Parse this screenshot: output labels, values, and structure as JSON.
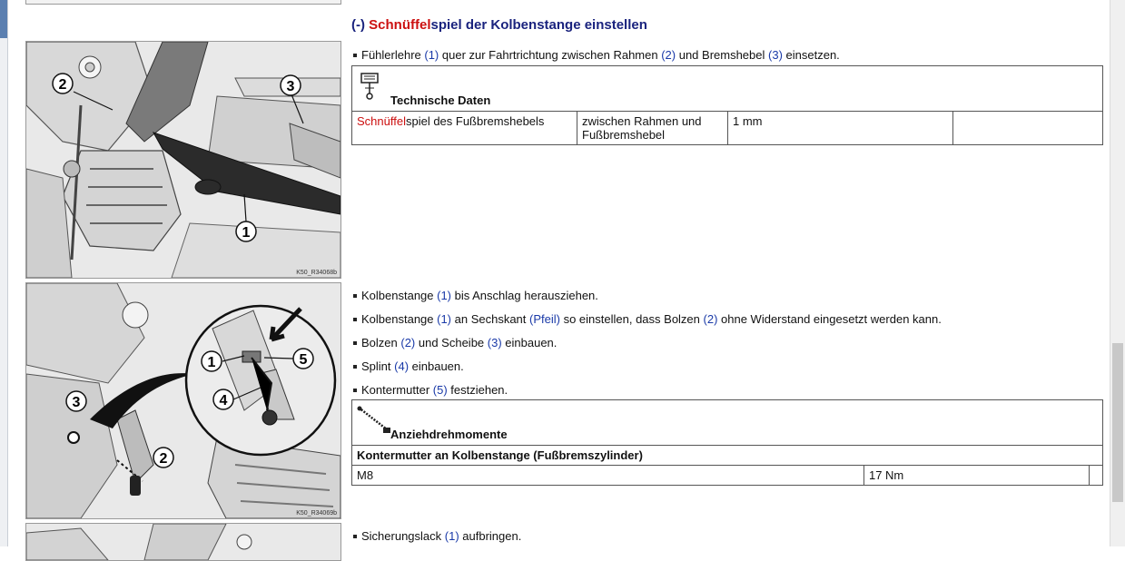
{
  "heading": {
    "prefix": "(-) ",
    "highlight": "Schnüffel",
    "rest": "spiel der Kolbenstange einstellen"
  },
  "step1": {
    "t1": "Fühlerlehre ",
    "r1": "(1)",
    "t2": " quer zur Fahrtrichtung zwischen Rahmen ",
    "r2": "(2)",
    "t3": " und Bremshebel ",
    "r3": "(3)",
    "t4": " einsetzen."
  },
  "tech_table": {
    "title": "Technische Daten",
    "icon": "gauge-icon",
    "param_highlight": "Schnüffel",
    "param_rest": "spiel des Fußbremshebels",
    "condition_line1": "zwischen Rahmen und",
    "condition_line2": "Fußbremshebel",
    "value": "1 mm"
  },
  "steps2": [
    {
      "t1": "Kolbenstange ",
      "r1": "(1)",
      "t2": " bis Anschlag herausziehen."
    },
    {
      "t1": "Kolbenstange ",
      "r1": "(1)",
      "t2": " an Sechskant ",
      "r2": "(Pfeil)",
      "t3": " so einstellen, dass Bolzen ",
      "r3": "(2)",
      "t4": " ohne Widerstand eingesetzt werden kann."
    },
    {
      "t1": "Bolzen ",
      "r1": "(2)",
      "t2": " und Scheibe ",
      "r2": "(3)",
      "t3": " einbauen."
    },
    {
      "t1": "Splint ",
      "r1": "(4)",
      "t2": " einbauen."
    },
    {
      "t1": "Kontermutter ",
      "r1": "(5)",
      "t2": " festziehen."
    }
  ],
  "torque_table": {
    "title": "Anziehdrehmomente",
    "icon": "torque-wrench-icon",
    "subtitle": "Kontermutter an Kolbenstange (Fußbremszylinder)",
    "size": "M8",
    "value": "17 Nm"
  },
  "step3": {
    "t1": "Sicherungslack ",
    "r1": "(1)",
    "t2": " aufbringen."
  },
  "images": [
    {
      "code": "K50_R34068b",
      "labels": [
        "2",
        "3",
        "1"
      ]
    },
    {
      "code": "K50_R34069b",
      "labels": [
        "1",
        "5",
        "4",
        "3",
        "2"
      ]
    }
  ],
  "colors": {
    "heading": "#1a237e",
    "highlight": "#cc1010",
    "reference": "#1a3aa8"
  }
}
